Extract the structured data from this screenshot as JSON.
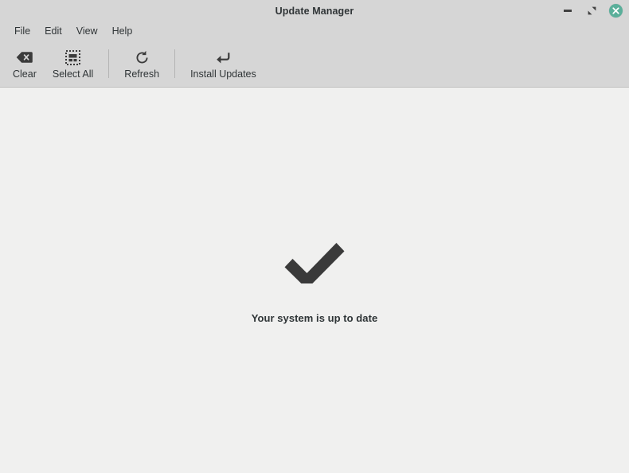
{
  "window": {
    "title": "Update Manager",
    "controls": {
      "minimize": {
        "label": "Minimize",
        "icon": "minimize-icon"
      },
      "maximize": {
        "label": "Maximize",
        "icon": "maximize-icon"
      },
      "close": {
        "label": "Close",
        "icon": "close-icon",
        "color": "#5aaf9a"
      }
    }
  },
  "menubar": {
    "items": [
      {
        "label": "File"
      },
      {
        "label": "Edit"
      },
      {
        "label": "View"
      },
      {
        "label": "Help"
      }
    ]
  },
  "toolbar": {
    "buttons": [
      {
        "label": "Clear",
        "icon": "backspace-delete-icon"
      },
      {
        "label": "Select All",
        "icon": "select-all-icon"
      },
      {
        "label": "Refresh",
        "icon": "refresh-icon"
      },
      {
        "label": "Install Updates",
        "icon": "install-arrow-icon"
      }
    ]
  },
  "content": {
    "status_icon": "checkmark-icon",
    "status_message": "Your system is up to date"
  },
  "colors": {
    "chrome": "#d6d6d6",
    "content_bg": "#f0f0ef",
    "text": "#2f3436",
    "icon": "#3b3b3b",
    "close_accent": "#5aaf9a"
  }
}
